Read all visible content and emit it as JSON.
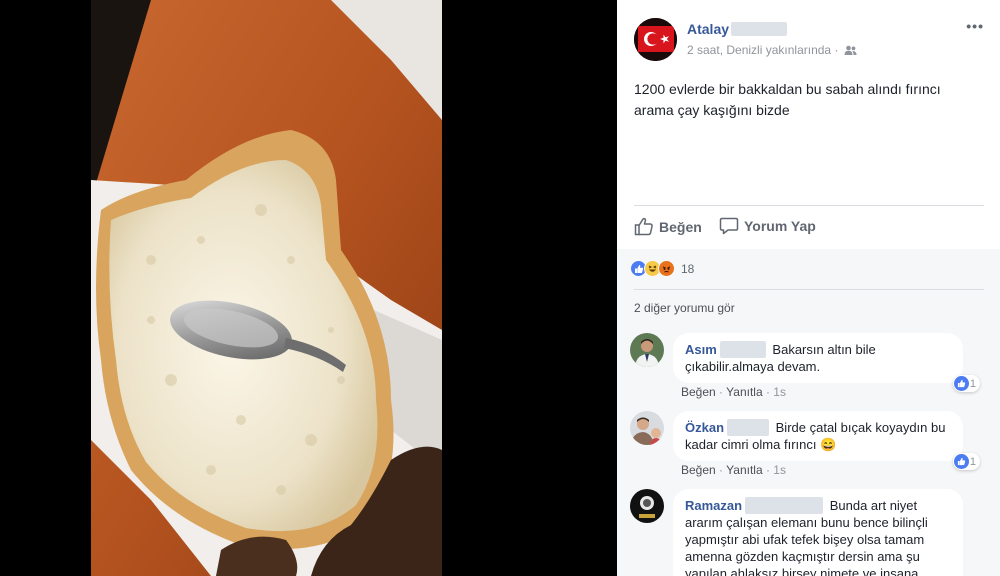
{
  "post": {
    "author": "Atalay",
    "time": "2 saat",
    "location": "Denizli yakınlarında",
    "separator": "·",
    "text_line1": "1200 evlerde bir bakkaldan bu sabah alındı fırıncı",
    "text_line2": "arama çay kaşığını bizde",
    "more_label": "•••"
  },
  "actions": {
    "like": "Beğen",
    "comment": "Yorum Yap"
  },
  "reactions": {
    "count": "18",
    "icons": [
      "like-icon",
      "haha-icon",
      "angry-icon"
    ]
  },
  "more_comments": "2 diğer yorumu gör",
  "comments": [
    {
      "name": "Asım",
      "text": "Bakarsın altın bile çıkabilir.almaya devam.",
      "like": "Beğen",
      "reply": "Yanıtla",
      "time": "1s",
      "reactions": "1"
    },
    {
      "name": "Özkan",
      "text": "Birde çatal bıçak koyaydın bu kadar cimri olma fırıncı",
      "emoji": "😄",
      "like": "Beğen",
      "reply": "Yanıtla",
      "time": "1s",
      "reactions": "1"
    },
    {
      "name": "Ramazan",
      "text": "Bunda art niyet ararım çalışan elemanı bunu bence bilinçli yapmıştır abi ufak tefek bişey olsa tamam amenna gözden kaçmıştır dersin ama şu yapılan ahlaksız birsey nimete ve insana"
    }
  ],
  "colors": {
    "link": "#365899",
    "like_blue": "#4267b2",
    "meta_gray": "#90949c",
    "comments_bg": "#f6f7f9"
  }
}
